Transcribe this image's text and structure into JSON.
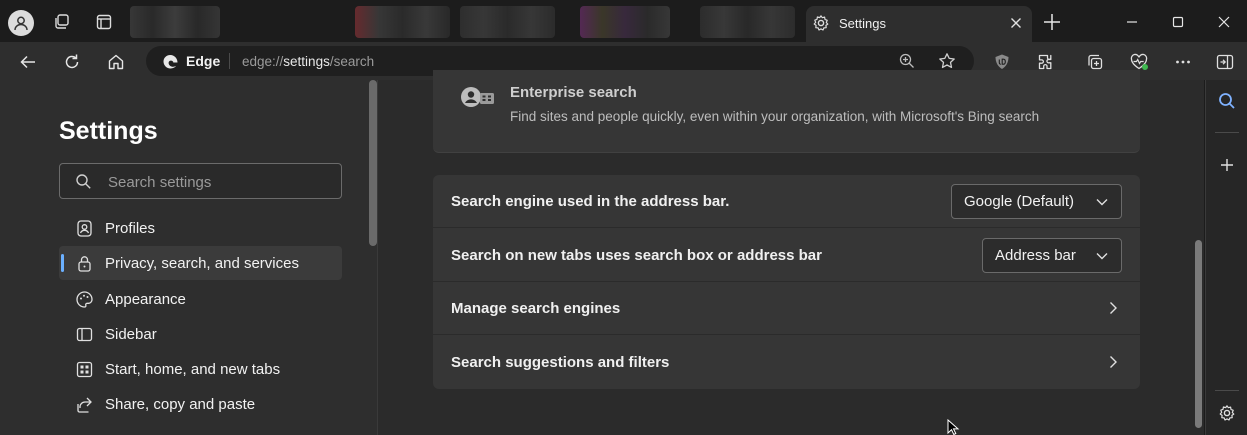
{
  "browser": {
    "active_tab_title": "Settings",
    "site_label": "Edge",
    "url_scheme": "edge://",
    "url_host": "settings",
    "url_path": "/search",
    "accent_color": "#6bb0ff"
  },
  "sidebar": {
    "title": "Settings",
    "search_placeholder": "Search settings",
    "items": [
      {
        "label": "Profiles",
        "icon": "profile-icon"
      },
      {
        "label": "Privacy, search, and services",
        "icon": "lock-icon",
        "selected": true
      },
      {
        "label": "Appearance",
        "icon": "palette-icon"
      },
      {
        "label": "Sidebar",
        "icon": "sidebar-icon"
      },
      {
        "label": "Start, home, and new tabs",
        "icon": "home-tabs-icon"
      },
      {
        "label": "Share, copy and paste",
        "icon": "share-icon"
      }
    ]
  },
  "main": {
    "enterprise": {
      "title": "Enterprise search",
      "description": "Find sites and people quickly, even within your organization, with Microsoft's Bing search"
    },
    "rows": [
      {
        "label": "Search engine used in the address bar.",
        "control": "dropdown",
        "value": "Google (Default)"
      },
      {
        "label": "Search on new tabs uses search box or address bar",
        "control": "dropdown",
        "value": "Address bar"
      },
      {
        "label": "Manage search engines",
        "control": "chevron"
      },
      {
        "label": "Search suggestions and filters",
        "control": "chevron"
      }
    ]
  }
}
